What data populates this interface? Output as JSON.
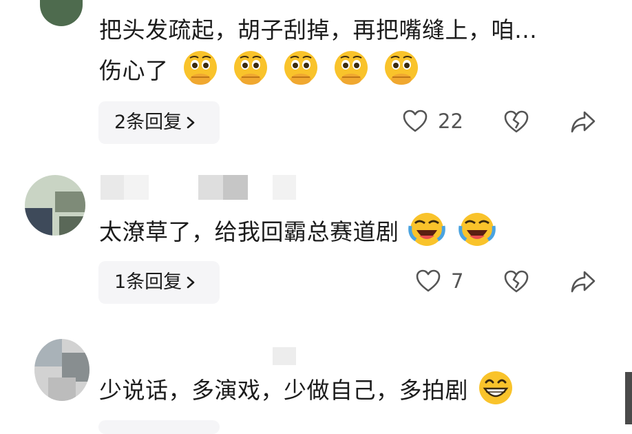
{
  "comments": [
    {
      "text_line1": "把头发疏起，胡子刮掉，再把嘴缝上，咱…",
      "text_line2": "伤心了",
      "emoji": "holding-back-tears-emoji",
      "replies_label": "2条回复",
      "likes": "22"
    },
    {
      "text": "太潦草了，给我回霸总赛道剧",
      "emoji": "rolling-laughing-emoji",
      "replies_label": "1条回复",
      "likes": "7"
    },
    {
      "text": "少说话，多演戏，少做自己，多拍剧",
      "emoji": "grinning-emoji"
    }
  ],
  "icons": {
    "like": "heart-icon",
    "dislike": "broken-heart-icon",
    "share": "share-arrow-icon",
    "chevron": "chevron-right-icon"
  },
  "colors": {
    "reply_bg": "#f5f5f7",
    "icon": "#555555",
    "emoji_yellow": "#f9c32b"
  }
}
